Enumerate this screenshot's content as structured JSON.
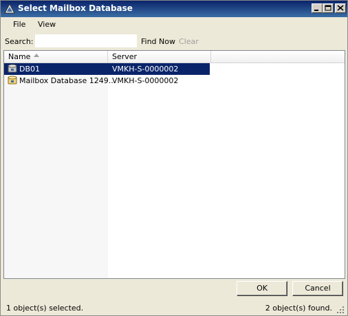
{
  "window": {
    "title": "Select Mailbox Database",
    "title_color": "#0a246a"
  },
  "menu": {
    "items": [
      {
        "label": "File"
      },
      {
        "label": "View"
      }
    ]
  },
  "search": {
    "label": "Search:",
    "value": "",
    "placeholder": "",
    "find_now": "Find Now",
    "clear": "Clear"
  },
  "table": {
    "columns": [
      {
        "label": "Name",
        "sorted": "ascending"
      },
      {
        "label": "Server"
      }
    ],
    "rows": [
      {
        "name": "DB01",
        "server": "VMKH-S-0000002",
        "icon": "database-icon",
        "selected": true
      },
      {
        "name": "Mailbox Database 1249...",
        "server": "VMKH-S-0000002",
        "icon": "database-icon",
        "selected": false
      }
    ],
    "selection_color": "#0a246a"
  },
  "buttons": {
    "ok": "OK",
    "cancel": "Cancel"
  },
  "status": {
    "selected_text": "1 object(s) selected.",
    "found_text": "2 object(s) found."
  }
}
